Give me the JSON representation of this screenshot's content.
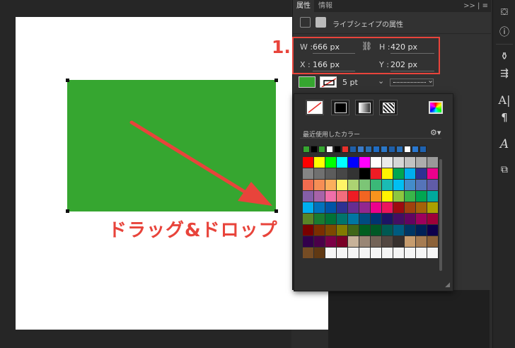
{
  "tabs": {
    "properties": "属性",
    "info": "情報",
    "controls": ">> | ≡"
  },
  "panel": {
    "title": "ライブシェイプの属性"
  },
  "transform": {
    "w_label": "W :",
    "w_value": "666 px",
    "h_label": "H :",
    "h_value": "420 px",
    "x_label": "X :",
    "x_value": "166 px",
    "y_label": "Y :",
    "y_value": "202 px"
  },
  "appearance": {
    "stroke_width": "5 pt",
    "stroke_width_chevron": "⌄",
    "stroke_style_chevron": "⌄",
    "fill_color": "#36a630"
  },
  "swatches_popover": {
    "recent_label": "最近使用したカラー",
    "gear": "⚙▾"
  },
  "annotations": {
    "step": "1.",
    "drag_label": "ドラッグ&ドロップ",
    "accent": "#e8443b"
  },
  "recent_colors": [
    "#36a630",
    "#000000",
    "#36a630",
    "#ffffff",
    "#000000",
    "#e8302b",
    "#1f5fa8",
    "#3a7bc8",
    "#2a6db0",
    "#1f6cc4",
    "#2b78c8",
    "#1f5fa8",
    "#2a70b8",
    "#ffffff",
    "#2a78d0",
    "#1e62b0"
  ],
  "swatch_grid": [
    [
      "#ff0000",
      "#ffff00",
      "#00ff00",
      "#00ffff",
      "#0000ff",
      "#ff00ff",
      "#ffffff",
      "#ebebeb",
      "#d6d6d6",
      "#c2c2c2",
      "#adadad",
      "#999999"
    ],
    [
      "#858585",
      "#707070",
      "#5c5c5c",
      "#474747",
      "#333333",
      "#000000",
      "#ed1c24",
      "#fff200",
      "#00a651",
      "#00aeef",
      "#2e3192",
      "#ec008c"
    ],
    [
      "#f26c4f",
      "#f68e55",
      "#fbaf5c",
      "#fff467",
      "#acd372",
      "#7cc576",
      "#3bb878",
      "#1abbb4",
      "#00bff3",
      "#438cca",
      "#5574b9",
      "#605ca8"
    ],
    [
      "#855fa8",
      "#a763a8",
      "#f06ea9",
      "#f26d7d",
      "#ed1c24",
      "#f26522",
      "#f7941d",
      "#fff200",
      "#8dc73f",
      "#39b54a",
      "#00a651",
      "#00a99d"
    ],
    [
      "#00aeef",
      "#0072bc",
      "#0054a6",
      "#2e3192",
      "#662d91",
      "#92278f",
      "#ec008c",
      "#ed145b",
      "#9e0b0f",
      "#a0410d",
      "#a36209",
      "#aba000"
    ],
    [
      "#598527",
      "#197b30",
      "#007236",
      "#00746b",
      "#0076a3",
      "#004b80",
      "#003471",
      "#1b1464",
      "#440e62",
      "#630460",
      "#9e005d",
      "#9e0039"
    ],
    [
      "#790000",
      "#7b2e00",
      "#7d4900",
      "#827b00",
      "#406618",
      "#005e20",
      "#005826",
      "#005952",
      "#005b7f",
      "#003663",
      "#002157",
      "#0d004c"
    ],
    [
      "#32004b",
      "#4b0049",
      "#7b0046",
      "#7a0026",
      "#c7b299",
      "#998675",
      "#736357",
      "#534741",
      "#37302d",
      "#c69c6e",
      "#a67c52",
      "#8c6239"
    ],
    [
      "#754c24",
      "#603913",
      "#f5f5f5",
      "#f5f5f5",
      "#f5f5f5",
      "#f5f5f5",
      "#f5f5f5",
      "#f5f5f5",
      "#f5f5f5",
      "#f5f5f5",
      "#f5f5f5",
      "#f5f5f5"
    ]
  ]
}
